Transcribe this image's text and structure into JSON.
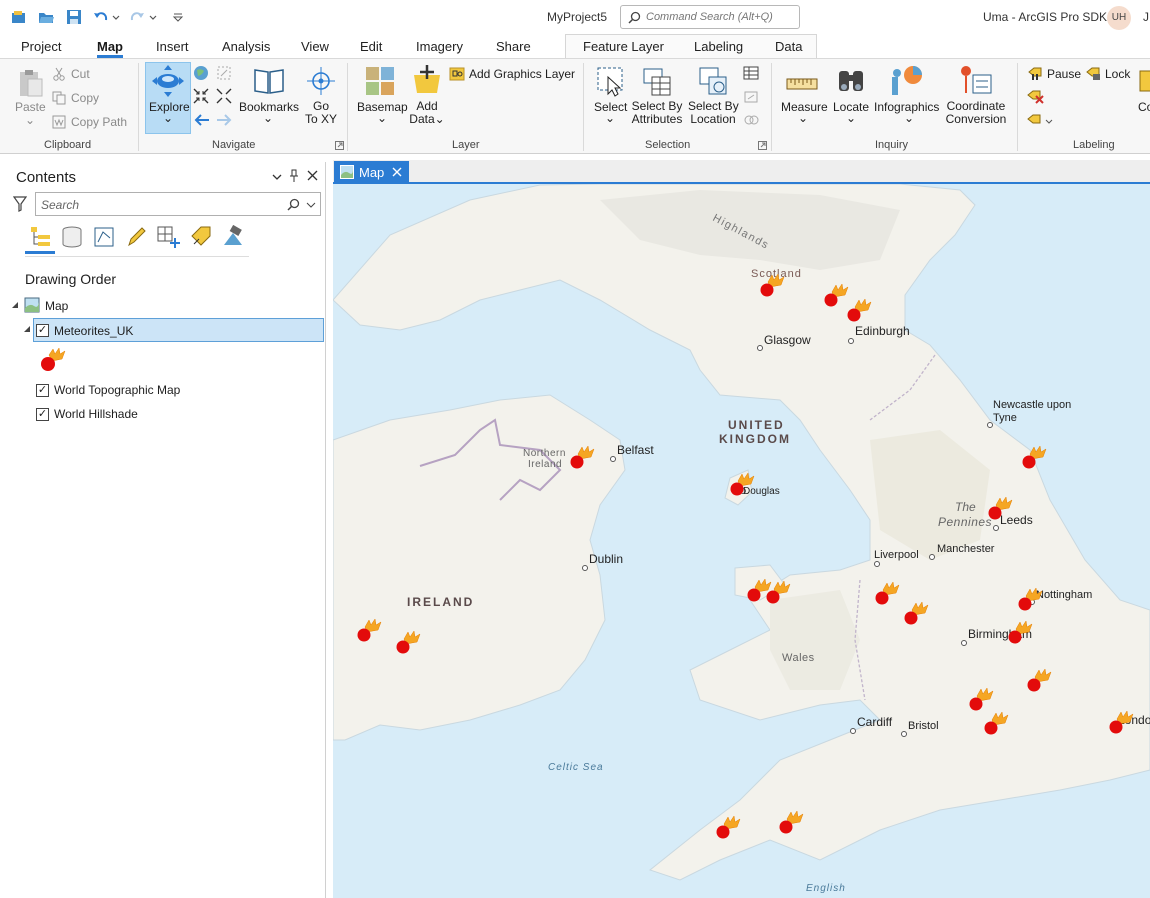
{
  "window": {
    "project_name": "MyProject5",
    "command_search_placeholder": "Command Search (Alt+Q)",
    "user_app_title": "Uma - ArcGIS Pro SDK",
    "user_initials": "UH",
    "overflow_text": "J"
  },
  "tabs": {
    "items": [
      "Project",
      "Map",
      "Insert",
      "Analysis",
      "View",
      "Edit",
      "Imagery",
      "Share"
    ],
    "active": "Map",
    "contextual": [
      "Feature Layer",
      "Labeling",
      "Data"
    ]
  },
  "ribbon": {
    "clipboard": {
      "label": "Clipboard",
      "paste": "Paste",
      "cut": "Cut",
      "copy": "Copy",
      "copy_path": "Copy Path"
    },
    "navigate": {
      "label": "Navigate",
      "explore": "Explore",
      "bookmarks": "Bookmarks",
      "go_to_xy_1": "Go",
      "go_to_xy_2": "To XY"
    },
    "layer": {
      "label": "Layer",
      "basemap": "Basemap",
      "add_data_1": "Add",
      "add_data_2": "Data",
      "add_graphics_layer": "Add Graphics Layer"
    },
    "selection": {
      "label": "Selection",
      "select": "Select",
      "select_by_attributes_1": "Select By",
      "select_by_attributes_2": "Attributes",
      "select_by_location_1": "Select By",
      "select_by_location_2": "Location"
    },
    "inquiry": {
      "label": "Inquiry",
      "measure": "Measure",
      "locate": "Locate",
      "infographics": "Infographics",
      "coordinate_conversion_1": "Coordinate",
      "coordinate_conversion_2": "Conversion"
    },
    "labeling": {
      "label": "Labeling",
      "pause": "Pause",
      "lock": "Lock",
      "overflow": "Co"
    },
    "colors": {
      "accent": "#2b7cd3",
      "explore_active": "#b8dcf5"
    }
  },
  "contents": {
    "title": "Contents",
    "search_placeholder": "Search",
    "drawing_order": "Drawing Order",
    "map_node": "Map",
    "layers": [
      {
        "name": "Meteorites_UK",
        "checked": true,
        "selected": true
      },
      {
        "name": "World Topographic Map",
        "checked": true
      },
      {
        "name": "World Hillshade",
        "checked": true
      }
    ]
  },
  "map_view": {
    "tab_label": "Map",
    "labels": {
      "highlands": "Highlands",
      "scotland": "Scotland",
      "glasgow": "Glasgow",
      "edinburgh": "Edinburgh",
      "uk_1": "UNITED",
      "uk_2": "KINGDOM",
      "newcastle_1": "Newcastle upon",
      "newcastle_2": "Tyne",
      "northern_ireland_1": "Northern",
      "northern_ireland_2": "Ireland",
      "belfast": "Belfast",
      "douglas": "Douglas",
      "pennines_1": "The",
      "pennines_2": "Pennines",
      "leeds": "Leeds",
      "dublin": "Dublin",
      "liverpool": "Liverpool",
      "manchester": "Manchester",
      "ireland": "IRELAND",
      "nottingham": "Nottingham",
      "birmingham": "Birmingham",
      "wales": "Wales",
      "cardiff": "Cardiff",
      "bristol": "Bristol",
      "london": "London",
      "celtic_sea": "Celtic Sea",
      "english": "English"
    },
    "colors": {
      "water": "#d7ecf8",
      "land": "#f3f2ec",
      "meteor_red": "#e30b0b",
      "meteor_flame": "#f5a623"
    }
  }
}
